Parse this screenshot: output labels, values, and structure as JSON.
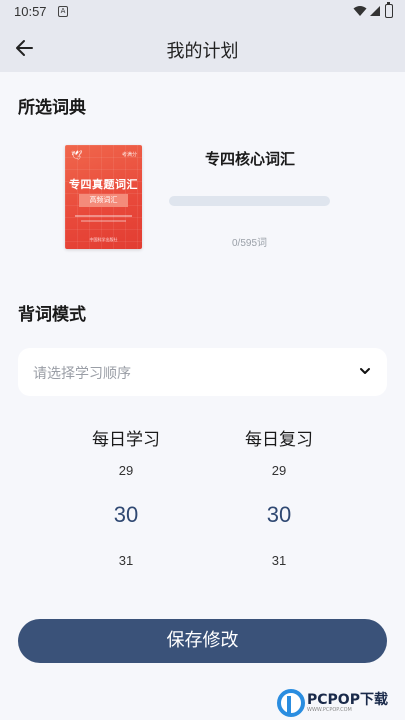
{
  "status_bar": {
    "time": "10:57",
    "notif_glyph": "A",
    "icons": [
      "wifi-icon",
      "signal-icon",
      "battery-icon"
    ]
  },
  "app_bar": {
    "title": "我的计划",
    "back_icon": "arrow-left-icon"
  },
  "dictionary_section": {
    "title": "所选词典",
    "book_cover": {
      "brand": "考满分",
      "title": "专四真题词汇",
      "subtitle": "高频词汇",
      "publisher": "中国科学出版社"
    },
    "name": "专四核心词汇",
    "progress": 0,
    "progress_text": "0/595词"
  },
  "mode_section": {
    "title": "背词模式",
    "order_select": {
      "placeholder": "请选择学习顺序",
      "icon": "chevron-down-icon"
    }
  },
  "pickers": {
    "daily_learn": {
      "label": "每日学习",
      "prev": "29",
      "selected": "30",
      "next": "31"
    },
    "daily_review": {
      "label": "每日复习",
      "prev": "29",
      "selected": "30",
      "next": "31"
    }
  },
  "save_button": {
    "label": "保存修改"
  },
  "watermark": {
    "text": "PCPOP下载",
    "sub": "WWW.PCPOP.COM"
  },
  "colors": {
    "accent": "#3a5279",
    "background": "#f6f7fb",
    "appbar": "#e6e8ef",
    "cover": "#e8483a"
  }
}
